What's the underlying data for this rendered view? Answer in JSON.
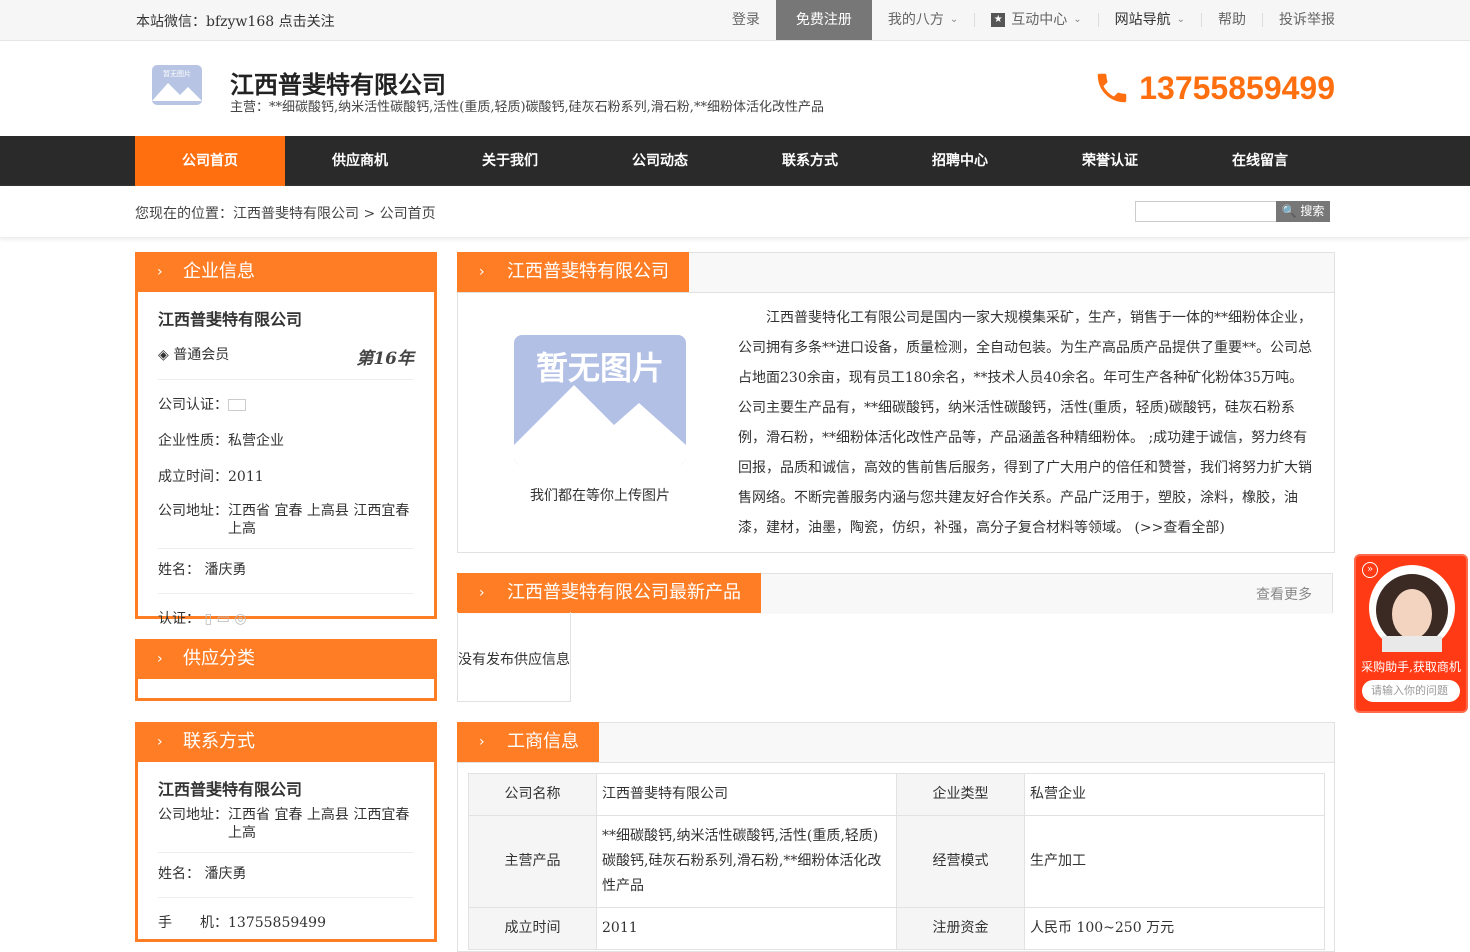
{
  "topbar": {
    "wechat": "本站微信：bfzyw168 点击关注",
    "login": "登录",
    "register": "免费注册",
    "my": "我的八方",
    "interact": "互动中心",
    "sitenav": "网站导航",
    "help": "帮助",
    "report": "投诉举报"
  },
  "header": {
    "company": "江西普斐特有限公司",
    "main_products": "主营：**细碳酸钙,纳米活性碳酸钙,活性(重质,轻质)碳酸钙,硅灰石粉系列,滑石粉,**细粉体活化改性产品",
    "phone": "13755859499",
    "logo_text": "暂无图片"
  },
  "nav": [
    "公司首页",
    "供应商机",
    "关于我们",
    "公司动态",
    "联系方式",
    "招聘中心",
    "荣誉认证",
    "在线留言"
  ],
  "crumb": "您现在的位置：江西普斐特有限公司 > 公司首页",
  "search_btn": "搜索",
  "left": {
    "info_title": "企业信息",
    "company": "江西普斐特有限公司",
    "member": "普通会员",
    "years": "第16年",
    "cert_label": "公司认证：",
    "nature": "企业性质：私营企业",
    "founded": "成立时间：2011",
    "addr_label": "公司地址：",
    "addr": "江西省 宜春 上高县 江西宜春上高",
    "name": "姓名： 潘庆勇",
    "auth": "认证：",
    "cat_title": "供应分类",
    "contact_title": "联系方式",
    "contact_company": "江西普斐特有限公司",
    "contact_addr_label": "公司地址：",
    "contact_addr": "江西省 宜春 上高县 江西宜春上高",
    "contact_name": "姓名： 潘庆勇",
    "mobile": "手　　机：13755859499"
  },
  "intro": {
    "title": "江西普斐特有限公司",
    "noimg": "暂无图片",
    "upload": "我们都在等你上传图片",
    "text": "江西普斐特化工有限公司是国内一家大规模集采矿，生产，销售于一体的**细粉体企业，公司拥有多条**进口设备，质量检测，全自动包装。为生产高品质产品提供了重要**。公司总占地面230余亩，现有员工180余名，**技术人员40余名。年可生产各种矿化粉体35万吨。公司主要生产品有，**细碳酸钙，纳米活性碳酸钙，活性(重质，轻质)碳酸钙，硅灰石粉系例，滑石粉，**细粉体活化改性产品等，产品涵盖各种精细粉体。 ;成功建于诚信，努力终有回报，品质和诚信，高效的售前售后服务，得到了广大用户的倍任和赞誉，我们将努力扩大销售网络。不断完善服务内涵与您共建友好合作关系。产品广泛用于，塑胶，涂料，橡胶，油漆，建材，油墨，陶瓷，仿织，补强，高分子复合材料等领域。 (>>查看全部)"
  },
  "products": {
    "title": "江西普斐特有限公司最新产品",
    "more": "查看更多",
    "empty": "没有发布供应信息"
  },
  "biz": {
    "title": "工商信息",
    "rows": [
      [
        "公司名称",
        "江西普斐特有限公司",
        "企业类型",
        "私营企业"
      ],
      [
        "主营产品",
        "**细碳酸钙,纳米活性碳酸钙,活性(重质,轻质)碳酸钙,硅灰石粉系列,滑石粉,**细粉体活化改性产品",
        "经营模式",
        "生产加工"
      ],
      [
        "成立时间",
        "2011",
        "注册资金",
        "人民币 100~250 万元"
      ]
    ]
  },
  "chat": {
    "line1": "采购助手,获取商机",
    "placeholder": "请输入你的问题"
  }
}
